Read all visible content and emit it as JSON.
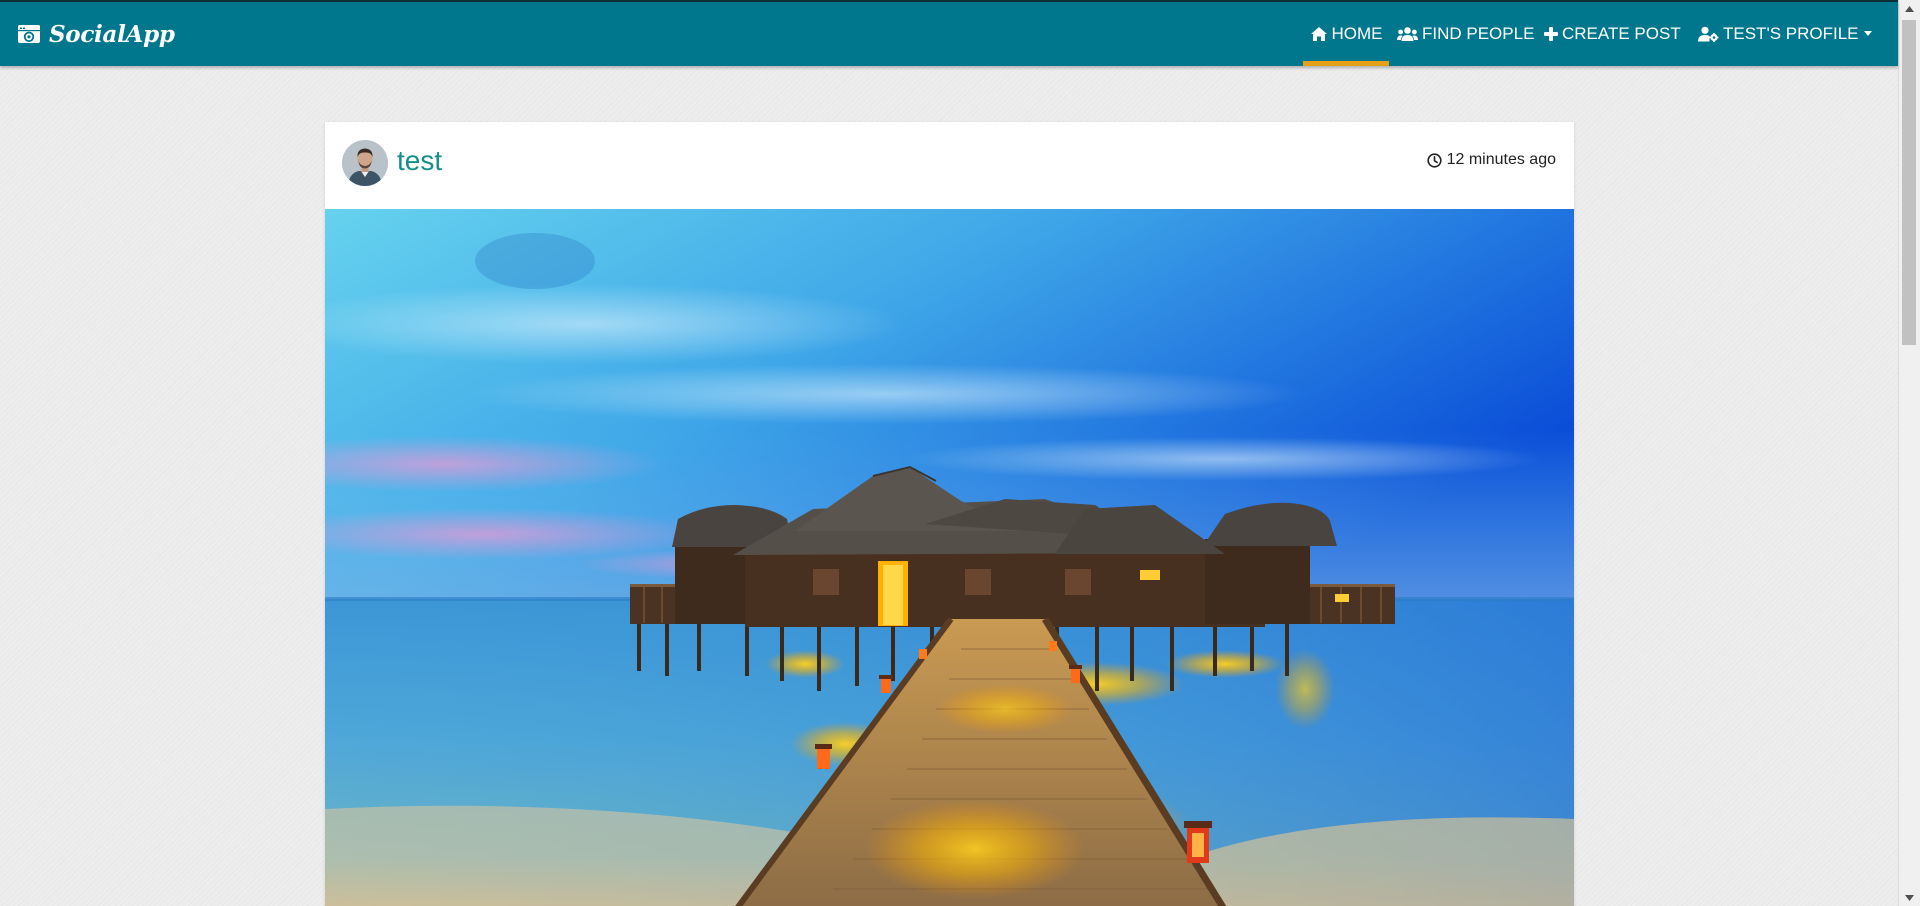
{
  "brand": {
    "name": "SocialApp",
    "icon": "camera-window-icon"
  },
  "nav": {
    "items": [
      {
        "label": "HOME",
        "icon": "home-icon",
        "active": true
      },
      {
        "label": "FIND PEOPLE",
        "icon": "users-icon",
        "active": false
      },
      {
        "label": "CREATE POST",
        "icon": "plus-icon",
        "active": false
      },
      {
        "label": "TEST'S PROFILE",
        "icon": "user-cog-icon",
        "active": false,
        "dropdown": true
      }
    ]
  },
  "post": {
    "author": "test",
    "time": "12 minutes ago",
    "image_subject": "overwater villa with lit wooden pier at dusk"
  },
  "colors": {
    "navbar": "#00778d",
    "active_indicator": "#e4a017",
    "author_link": "#148f8a",
    "page_background": "#ececec"
  }
}
